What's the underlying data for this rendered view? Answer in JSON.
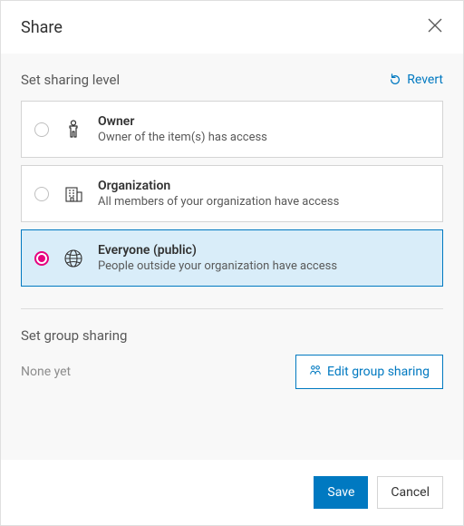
{
  "header": {
    "title": "Share"
  },
  "sharing": {
    "section_title": "Set sharing level",
    "revert_label": "Revert",
    "selected_index": 2,
    "options": [
      {
        "title": "Owner",
        "desc": "Owner of the item(s) has access"
      },
      {
        "title": "Organization",
        "desc": "All members of your organization have access"
      },
      {
        "title": "Everyone (public)",
        "desc": "People outside your organization have access"
      }
    ]
  },
  "group_sharing": {
    "section_title": "Set group sharing",
    "empty_label": "None yet",
    "edit_button": "Edit group sharing"
  },
  "footer": {
    "save": "Save",
    "cancel": "Cancel"
  }
}
